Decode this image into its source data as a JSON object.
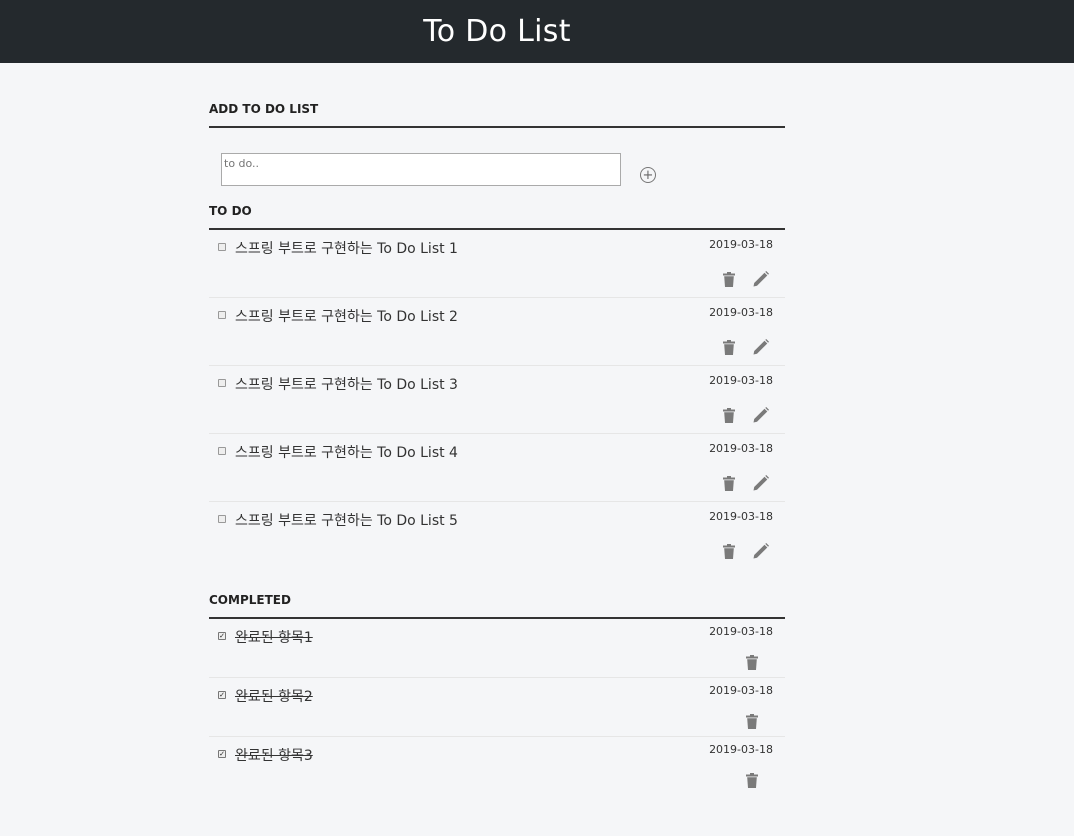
{
  "header": {
    "title": "To Do List"
  },
  "add_section": {
    "title": "ADD TO DO LIST",
    "placeholder": "to do.."
  },
  "todo_section": {
    "title": "TO DO",
    "items": [
      {
        "text": "스프링 부트로 구현하는 To Do List 1",
        "date": "2019-03-18"
      },
      {
        "text": "스프링 부트로 구현하는 To Do List 2",
        "date": "2019-03-18"
      },
      {
        "text": "스프링 부트로 구현하는 To Do List 3",
        "date": "2019-03-18"
      },
      {
        "text": "스프링 부트로 구현하는 To Do List 4",
        "date": "2019-03-18"
      },
      {
        "text": "스프링 부트로 구현하는 To Do List 5",
        "date": "2019-03-18"
      }
    ]
  },
  "completed_section": {
    "title": "COMPLETED",
    "items": [
      {
        "text": "완료된 항목1",
        "date": "2019-03-18"
      },
      {
        "text": "완료된 항목2",
        "date": "2019-03-18"
      },
      {
        "text": "완료된 항목3",
        "date": "2019-03-18"
      }
    ]
  },
  "icons": {
    "add": "plus-circle-icon",
    "delete": "trash-icon",
    "edit": "pencil-icon"
  },
  "colors": {
    "header_bg": "#24292d",
    "icon": "#777777"
  }
}
